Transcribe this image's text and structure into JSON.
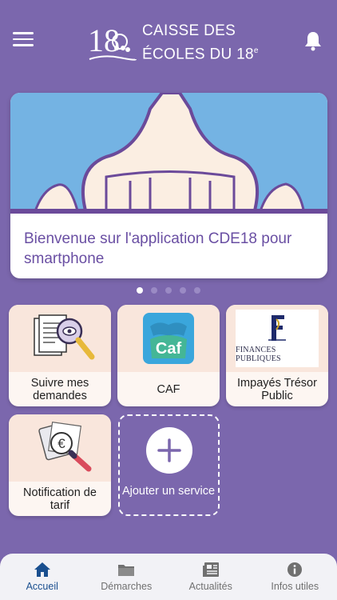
{
  "header": {
    "brand_line1": "CAISSE DES",
    "brand_line2": "ÉCOLES DU 18",
    "brand_sup": "e",
    "menu_icon": "hamburger-icon",
    "bell_icon": "bell-icon"
  },
  "carousel": {
    "caption": "Bienvenue sur l'application CDE18 pour smartphone",
    "slide_count": 5,
    "active_slide": 1
  },
  "services": [
    {
      "label": "Suivre mes demandes",
      "icon": "documents-magnifier-icon"
    },
    {
      "label": "CAF",
      "icon": "caf-logo-icon",
      "logo_text": "Caf"
    },
    {
      "label": "Impayés Trésor Public",
      "icon": "finances-publiques-logo",
      "logo_text": "FINANCES PUBLIQUES"
    },
    {
      "label": "Notification de tarif",
      "icon": "calculator-euro-icon"
    }
  ],
  "add_service": {
    "label": "Ajouter un service",
    "icon": "plus-icon"
  },
  "tabs": [
    {
      "label": "Accueil",
      "icon": "home-icon",
      "active": true
    },
    {
      "label": "Démarches",
      "icon": "folder-icon",
      "active": false
    },
    {
      "label": "Actualités",
      "icon": "newspaper-icon",
      "active": false
    },
    {
      "label": "Infos utiles",
      "icon": "info-icon",
      "active": false
    }
  ],
  "colors": {
    "background": "#7b67ad",
    "accent_text": "#6a4fa3",
    "active_tab": "#1a4f8f",
    "tile_top": "#f9e6dc"
  }
}
